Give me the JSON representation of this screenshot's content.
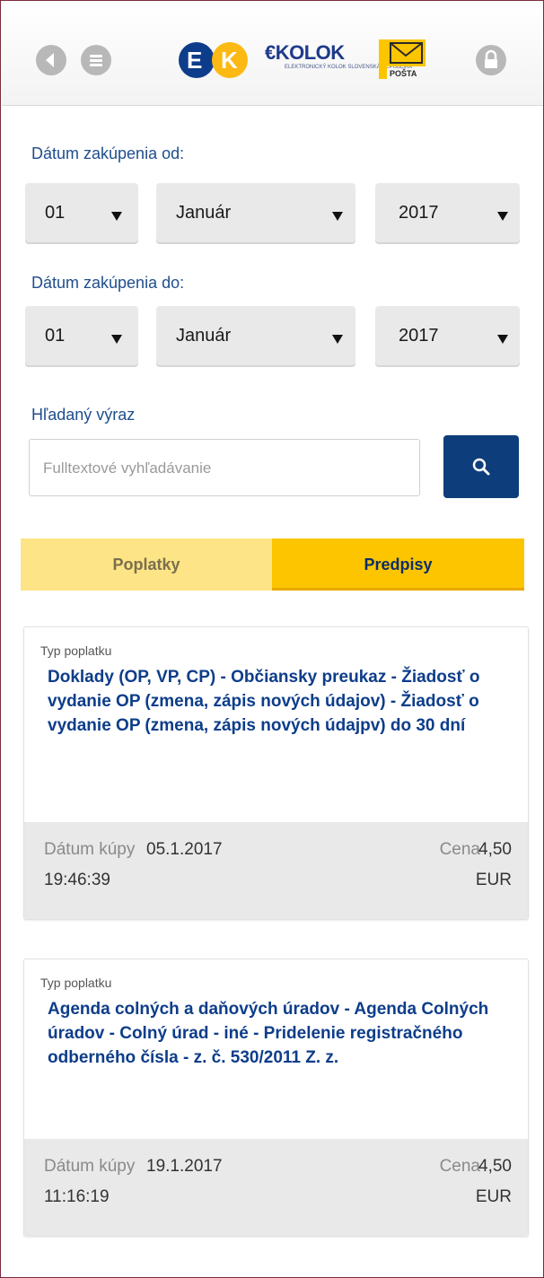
{
  "header": {
    "logo_ek_text": "EK",
    "logo_ekolok_word": "€KOLOK",
    "logo_ekolok_sub": "ELEKTRONICKÝ KOLOK SLOVENSKÁ REPUBLIKA",
    "logo_posta_text": "POŠTA",
    "icons": [
      "back-icon",
      "menu-icon",
      "lock-icon"
    ]
  },
  "form": {
    "date_from_label": "Dátum zakúpenia od:",
    "date_to_label": "Dátum zakúpenia do:",
    "from": {
      "day": "01",
      "month": "Január",
      "year": "2017"
    },
    "to": {
      "day": "01",
      "month": "Január",
      "year": "2017"
    },
    "search_label": "Hľadaný výraz",
    "search_placeholder": "Fulltextové vyhľadávanie"
  },
  "tabs": [
    {
      "label": "Poplatky",
      "active": false
    },
    {
      "label": "Predpisy",
      "active": true
    }
  ],
  "records": [
    {
      "type_label": "Typ poplatku",
      "title": "Doklady  (OP, VP, CP)  -  Občiansky preukaz - Žiadosť o vydanie OP (zmena, zápis nových údajov) - Žiadosť o vydanie OP (zmena, zápis nových údajpv) do 30 dní",
      "date_label": "Dátum kúpy",
      "date": "05.1.2017",
      "time": "19:46:39",
      "price_label": "Cena",
      "price": "4,50",
      "currency": "EUR"
    },
    {
      "type_label": "Typ poplatku",
      "title": "Agenda colných a daňových úradov - Agenda Colných úradov - Colný úrad - iné - Pridelenie registračného odberného čísla - z. č. 530/2011 Z. z.",
      "date_label": "Dátum kúpy",
      "date": "19.1.2017",
      "time": "11:16:19",
      "price_label": "Cena",
      "price": "4,50",
      "currency": "EUR"
    }
  ],
  "colors": {
    "accent_blue": "#0d3d7a",
    "tab_active": "#fcc500",
    "tab_inactive": "#fde486",
    "label_blue": "#1f4e8c"
  }
}
